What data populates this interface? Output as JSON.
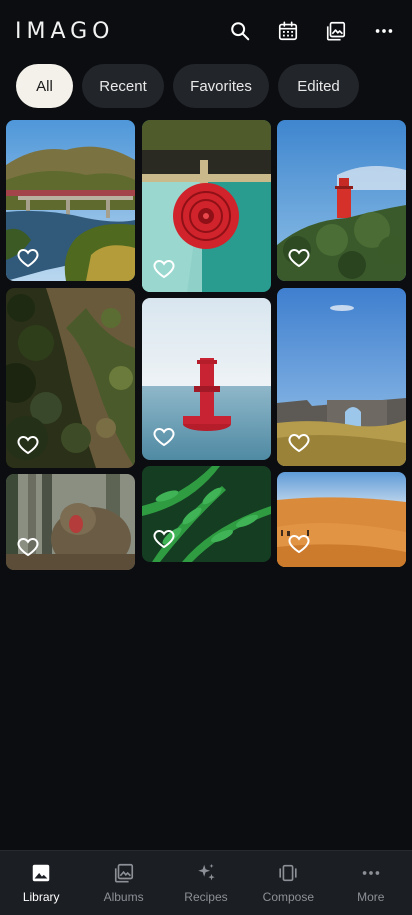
{
  "app": {
    "logo": "IMAGO"
  },
  "header": {
    "actions": [
      {
        "name": "search-icon"
      },
      {
        "name": "calendar-icon"
      },
      {
        "name": "gallery-icon"
      },
      {
        "name": "more-horizontal-icon"
      }
    ]
  },
  "filters": {
    "chips": [
      {
        "label": "All",
        "active": true
      },
      {
        "label": "Recent",
        "active": false
      },
      {
        "label": "Favorites",
        "active": false
      },
      {
        "label": "Edited",
        "active": false
      }
    ]
  },
  "photos": [
    {
      "subject": "valley with railway bridge and river",
      "favorite": false
    },
    {
      "subject": "red lifebuoy on teal water",
      "favorite": false
    },
    {
      "subject": "red lighthouse on green hill",
      "favorite": false
    },
    {
      "subject": "forested mountain slope",
      "favorite": false
    },
    {
      "subject": "red buoy in the sea",
      "favorite": false
    },
    {
      "subject": "stone ruins arch on grassland",
      "favorite": false
    },
    {
      "subject": "monkey yawning in forest",
      "favorite": false
    },
    {
      "subject": "green fern leaves",
      "favorite": false
    },
    {
      "subject": "orange desert dunes with camels",
      "favorite": false
    }
  ],
  "bottom_nav": {
    "items": [
      {
        "label": "Library",
        "icon": "image-icon",
        "active": true
      },
      {
        "label": "Albums",
        "icon": "albums-icon",
        "active": false
      },
      {
        "label": "Recipes",
        "icon": "sparkles-icon",
        "active": false
      },
      {
        "label": "Compose",
        "icon": "compose-icon",
        "active": false
      },
      {
        "label": "More",
        "icon": "more-icon",
        "active": false
      }
    ]
  },
  "colors": {
    "background": "#0b0d10",
    "chip_bg": "#22252a",
    "chip_active_bg": "#f4f1ea",
    "nav_bg": "#1b1e23"
  }
}
